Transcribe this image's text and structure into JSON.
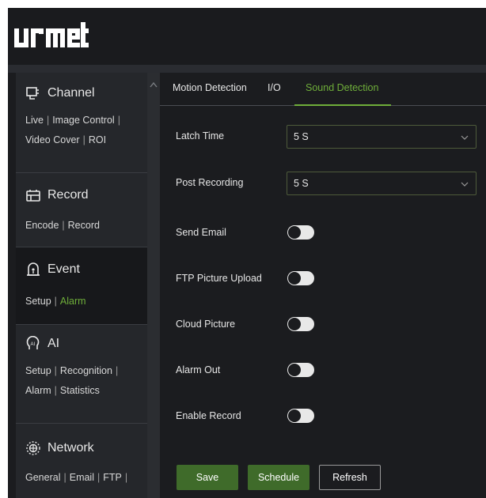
{
  "header": {
    "brand": "urmet"
  },
  "sidebar": {
    "sections": [
      {
        "title": "Channel",
        "icon": "channel-icon",
        "links": [
          "Live",
          "Image Control",
          "Video Cover",
          "ROI"
        ]
      },
      {
        "title": "Record",
        "icon": "record-icon",
        "links": [
          "Encode",
          "Record"
        ]
      },
      {
        "title": "Event",
        "icon": "event-icon",
        "links": [
          "Setup",
          "Alarm"
        ],
        "active_link": "Alarm"
      },
      {
        "title": "AI",
        "icon": "ai-icon",
        "links": [
          "Setup",
          "Recognition",
          "Alarm",
          "Statistics"
        ]
      },
      {
        "title": "Network",
        "icon": "network-icon",
        "links": [
          "General",
          "Email",
          "FTP"
        ]
      }
    ],
    "separator": "|"
  },
  "tabs": {
    "items": [
      "Motion Detection",
      "I/O",
      "Sound Detection"
    ],
    "active": "Sound Detection"
  },
  "form": {
    "latch_time": {
      "label": "Latch Time",
      "value": "5 S"
    },
    "post_recording": {
      "label": "Post Recording",
      "value": "5 S"
    },
    "send_email": {
      "label": "Send Email",
      "enabled": false
    },
    "ftp_picture_upload": {
      "label": "FTP Picture Upload",
      "enabled": false
    },
    "cloud_picture": {
      "label": "Cloud Picture",
      "enabled": false
    },
    "alarm_out": {
      "label": "Alarm Out",
      "enabled": false
    },
    "enable_record": {
      "label": "Enable Record",
      "enabled": false
    }
  },
  "buttons": {
    "save": "Save",
    "schedule": "Schedule",
    "refresh": "Refresh"
  },
  "colors": {
    "accent": "#6fae3a",
    "button_green": "#3f6b2a",
    "background": "#1b1c1f",
    "sidebar": "#25272b"
  }
}
